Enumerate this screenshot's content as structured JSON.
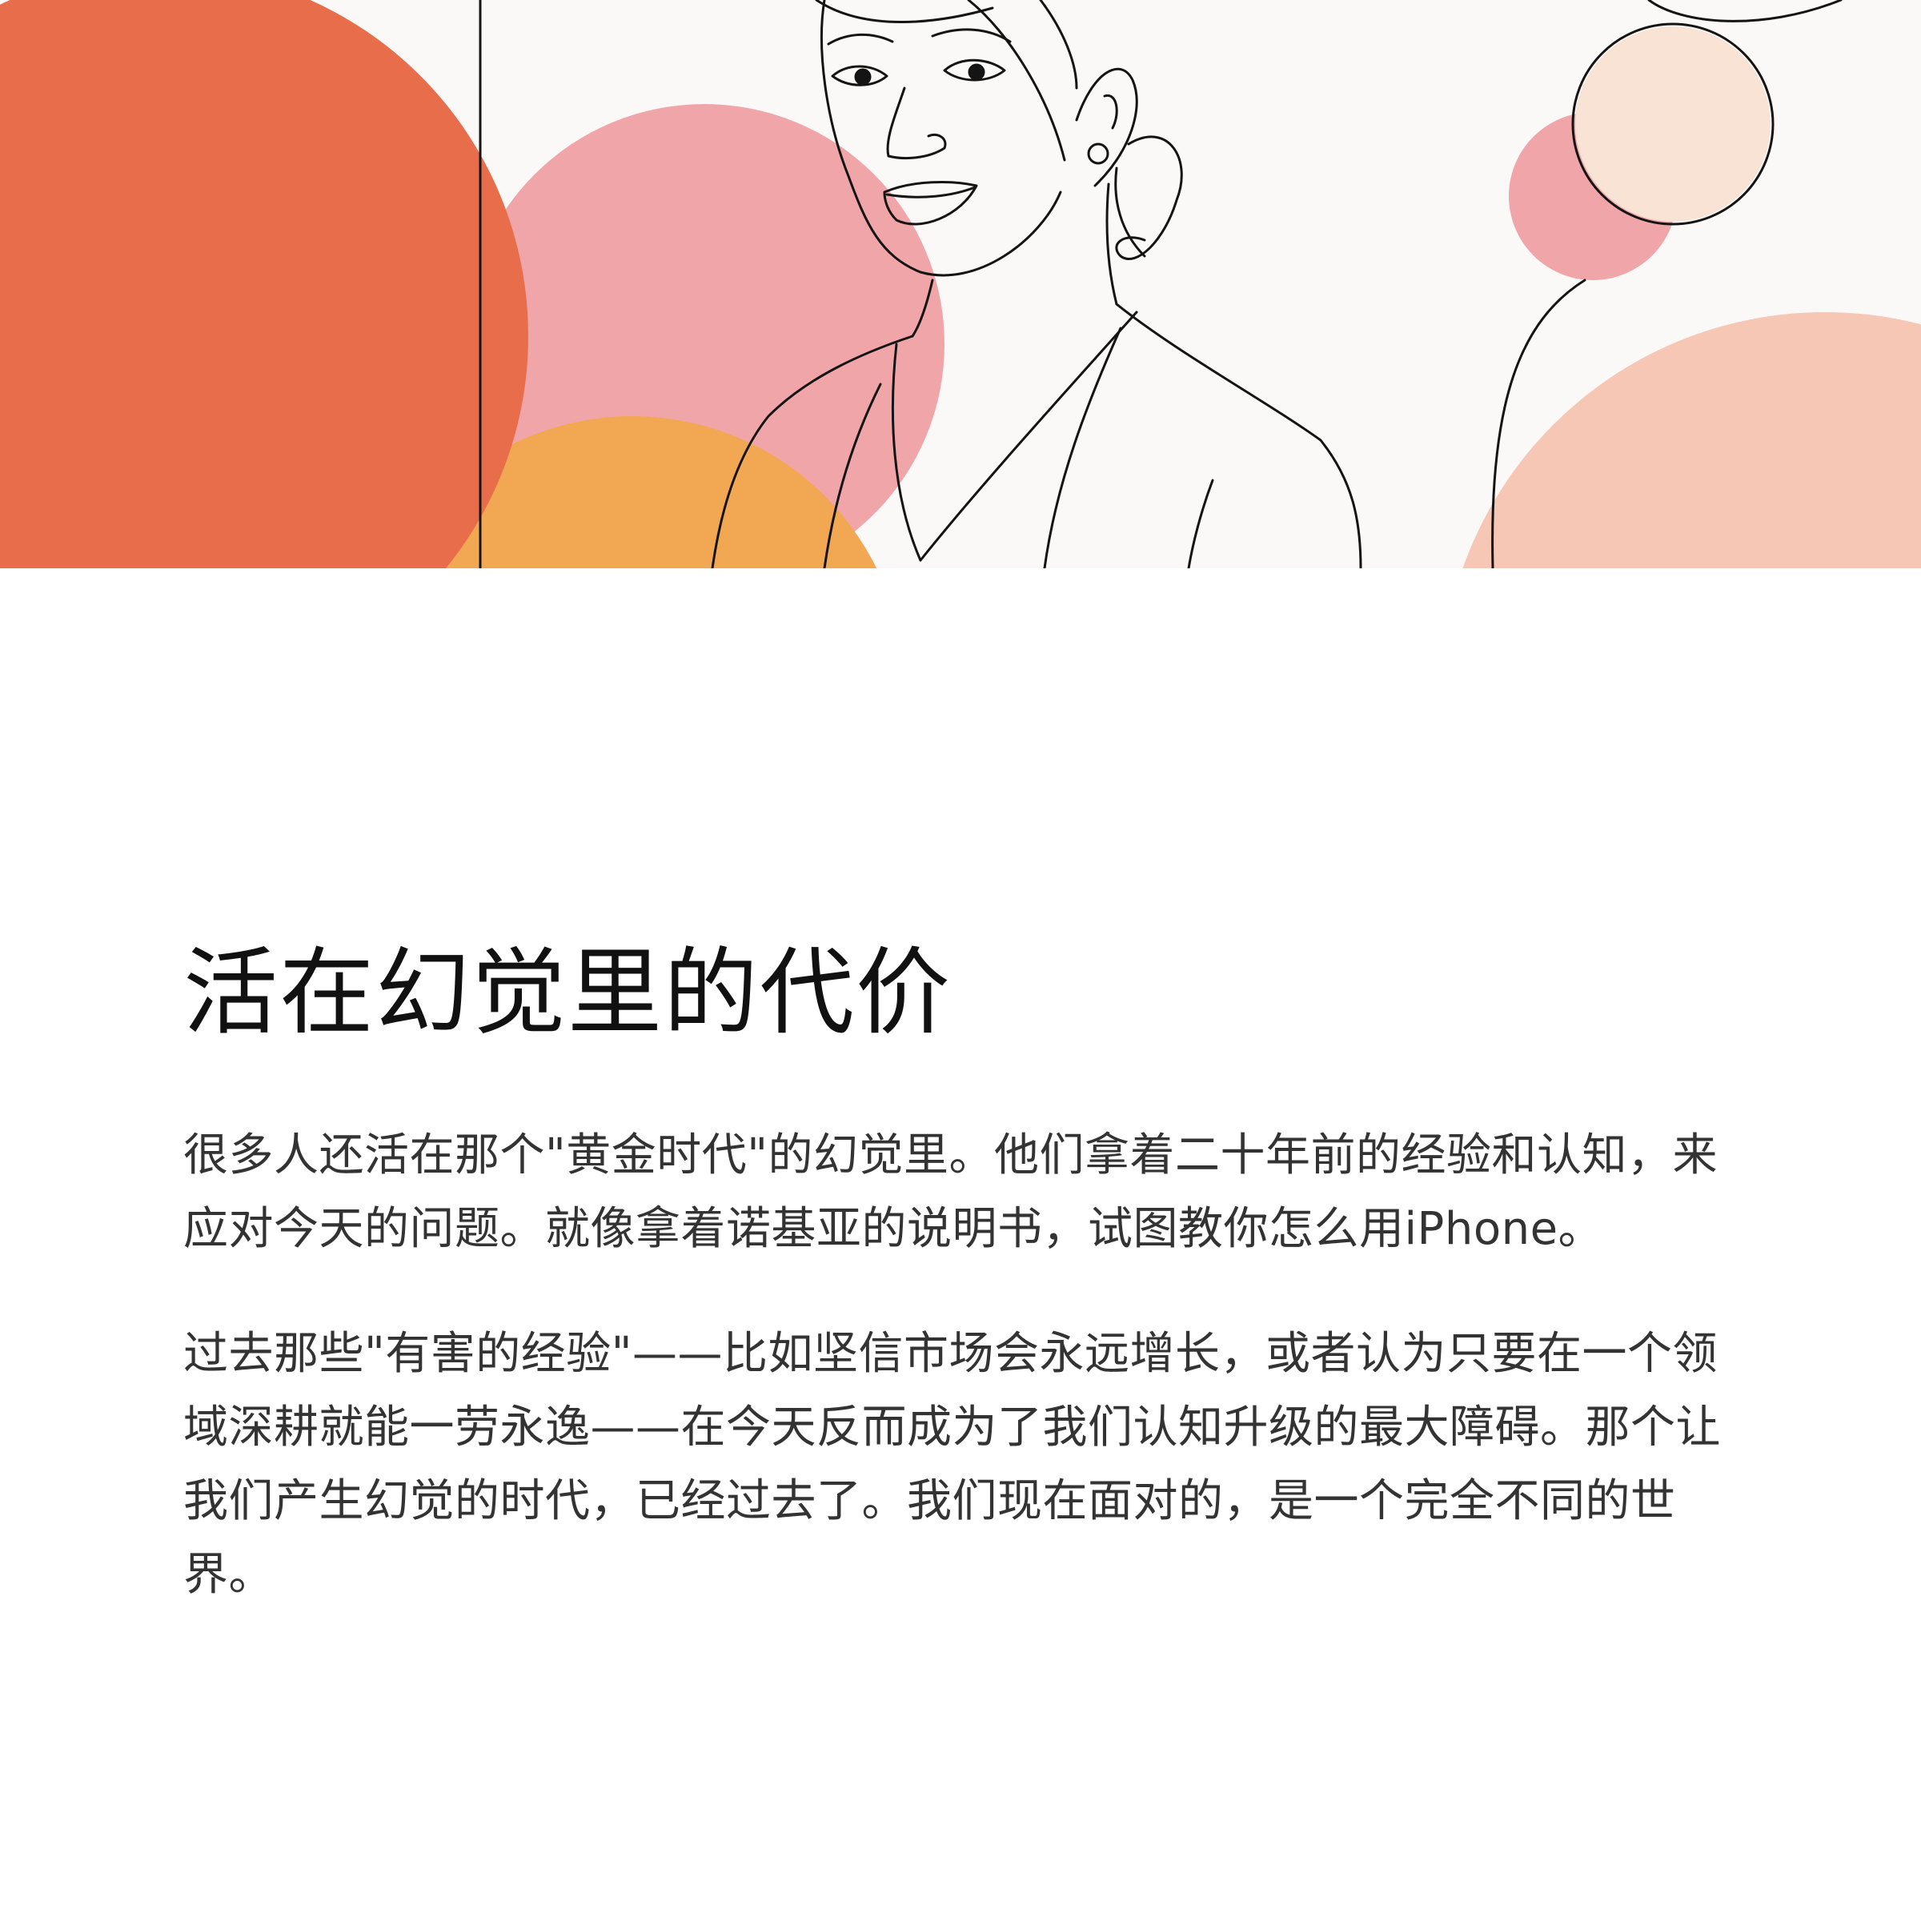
{
  "illustration": {
    "icon": "woman-line-portrait-illustration",
    "colors": {
      "background": "#fbf9f8",
      "coral": "#e86e4b",
      "pink": "#f0a6a9",
      "orange": "#f2a752",
      "peach": "#f5c7b4",
      "cream": "#f9e3d4",
      "line": "#141414"
    }
  },
  "article": {
    "title": "活在幻觉里的代价",
    "paragraphs": [
      "很多人还活在那个\"黄金时代\"的幻觉里。他们拿着二十年前的经验和认知，来应对今天的问题。就像拿着诺基亚的说明书，试图教你怎么用iPhone。",
      "过去那些\"有害的经验\"——比如坚信市场会永远增长，或者认为只要在一个领域深耕就能一劳永逸——在今天反而成为了我们认知升级的最大障碍。那个让我们产生幻觉的时代，已经过去了。我们现在面对的，是一个完全不同的世界。"
    ]
  }
}
